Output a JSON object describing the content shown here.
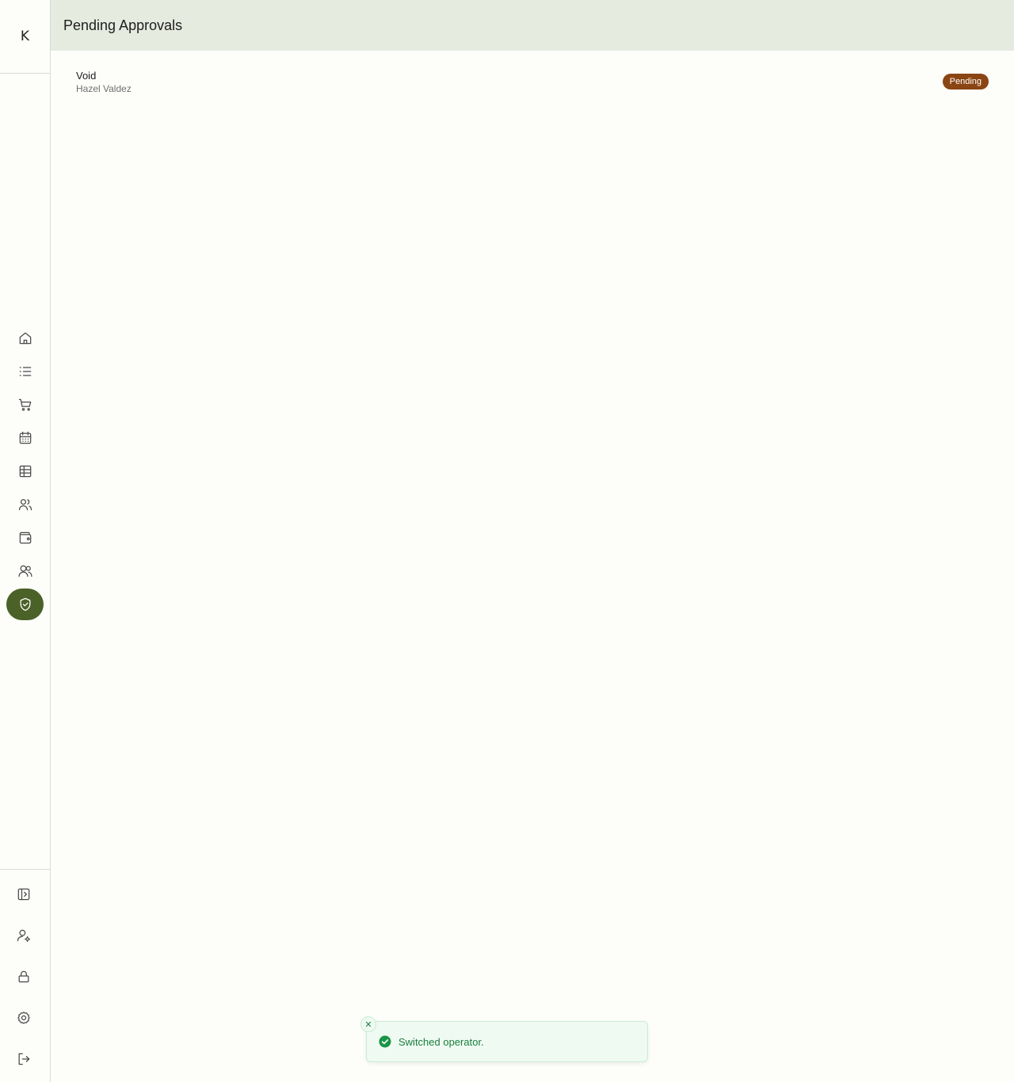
{
  "app": {
    "logo_letter": "K"
  },
  "header": {
    "title": "Pending Approvals"
  },
  "sidebar": {
    "items": [
      {
        "icon": "home-icon"
      },
      {
        "icon": "list-icon"
      },
      {
        "icon": "cart-icon"
      },
      {
        "icon": "calendar-icon"
      },
      {
        "icon": "table-icon"
      },
      {
        "icon": "users-icon"
      },
      {
        "icon": "wallet-icon"
      },
      {
        "icon": "team-icon"
      },
      {
        "icon": "shield-check-icon",
        "active": true
      }
    ],
    "bottom_items": [
      {
        "icon": "sidebar-toggle-icon"
      },
      {
        "icon": "user-settings-icon"
      },
      {
        "icon": "lock-icon"
      },
      {
        "icon": "gear-icon"
      },
      {
        "icon": "logout-icon"
      }
    ],
    "active_color": "#4a6128"
  },
  "approvals": [
    {
      "title": "Void",
      "subtitle": "Hazel Valdez",
      "status": "Pending",
      "status_color": "#8a4513"
    }
  ],
  "toast": {
    "message": "Switched operator.",
    "close_glyph": "✕",
    "color": "#1a7d3c"
  }
}
